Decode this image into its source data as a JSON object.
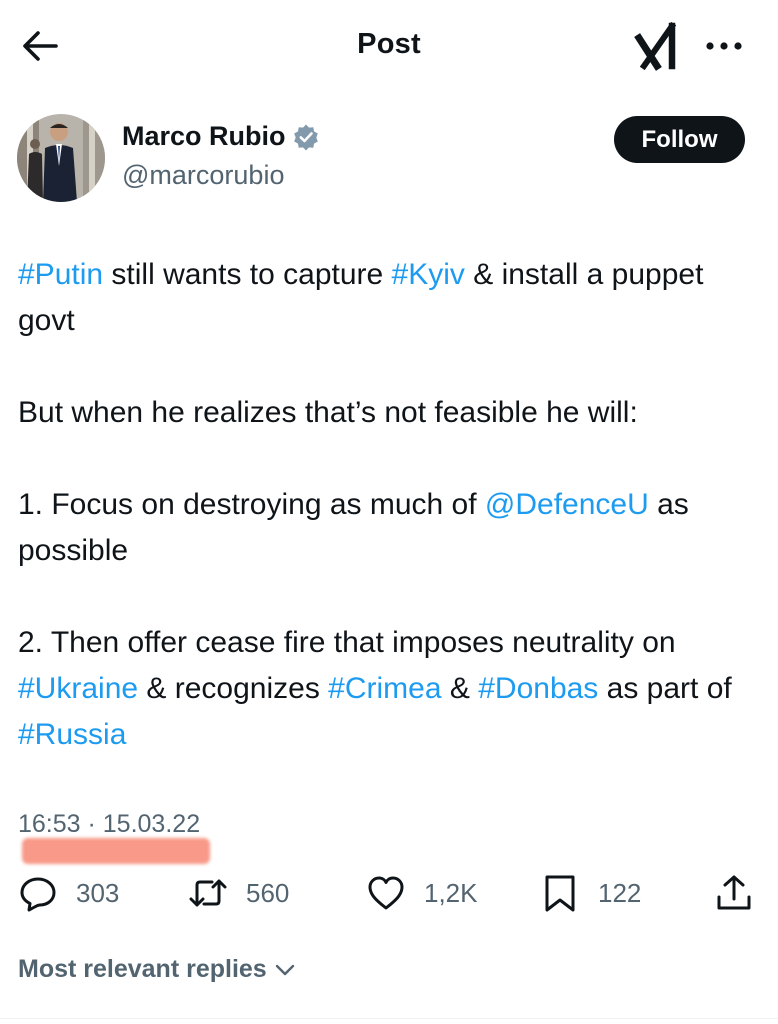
{
  "header": {
    "title": "Post",
    "back_icon": "arrow-left-icon",
    "grok_icon": "grok-icon",
    "more_icon": "more-horizontal-icon"
  },
  "author": {
    "name": "Marco Rubio",
    "handle": "@marcorubio",
    "verified_icon": "verified-badge-icon",
    "follow_label": "Follow"
  },
  "tweet": {
    "paragraphs": [
      [
        {
          "text": "#Putin",
          "link": true
        },
        {
          "text": " still wants to capture ",
          "link": false
        },
        {
          "text": "#Kyiv",
          "link": true
        },
        {
          "text": " & install a puppet govt",
          "link": false
        }
      ],
      [
        {
          "text": "But when he realizes that’s not feasible he will:",
          "link": false
        }
      ],
      [
        {
          "text": "1. Focus on destroying as much of ",
          "link": false
        },
        {
          "text": "@DefenceU",
          "link": true
        },
        {
          "text": " as possible",
          "link": false
        }
      ],
      [
        {
          "text": "2. Then offer cease fire that imposes neutrality on ",
          "link": false
        },
        {
          "text": "#Ukraine",
          "link": true
        },
        {
          "text": " & recognizes ",
          "link": false
        },
        {
          "text": "#Crimea",
          "link": true
        },
        {
          "text": " & ",
          "link": false
        },
        {
          "text": "#Donbas",
          "link": true
        },
        {
          "text": " as part of ",
          "link": false
        },
        {
          "text": "#Russia",
          "link": true
        }
      ]
    ],
    "timestamp": "16:53 · 15.03.22"
  },
  "metrics": {
    "replies": "303",
    "reposts": "560",
    "likes": "1,2K",
    "bookmarks": "122"
  },
  "icons": {
    "reply": "reply-icon",
    "repost": "repost-icon",
    "like": "heart-icon",
    "bookmark": "bookmark-icon",
    "share": "share-icon"
  },
  "replies_sort": {
    "label": "Most relevant replies",
    "icon": "chevron-down-icon"
  },
  "colors": {
    "link": "#1d9bf0",
    "text": "#0f1419",
    "secondary": "#536471",
    "verified": "#829aab",
    "follow_bg": "#0f1419",
    "redaction": "#f8917f"
  }
}
